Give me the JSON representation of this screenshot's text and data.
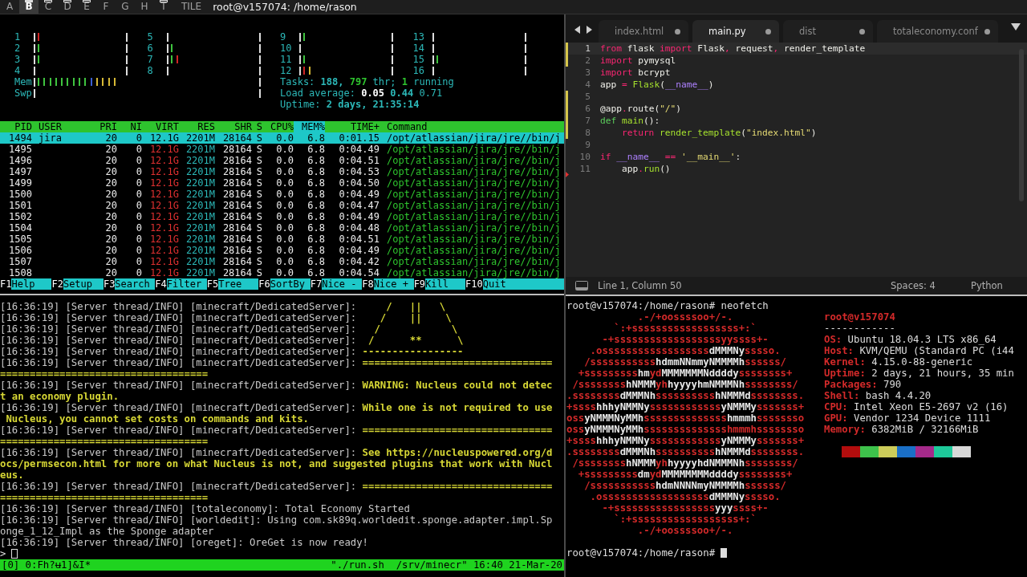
{
  "topbar": {
    "workspaces": [
      {
        "label": "A",
        "selected": false,
        "occupied": false
      },
      {
        "label": "B",
        "selected": true,
        "occupied": true
      },
      {
        "label": "C",
        "selected": false,
        "occupied": true
      },
      {
        "label": "D",
        "selected": false,
        "occupied": true
      },
      {
        "label": "E",
        "selected": false,
        "occupied": true
      },
      {
        "label": "F",
        "selected": false,
        "occupied": false
      },
      {
        "label": "G",
        "selected": false,
        "occupied": false
      },
      {
        "label": "H",
        "selected": false,
        "occupied": false
      },
      {
        "label": "T",
        "selected": false,
        "occupied": true
      }
    ],
    "layout": "TILE",
    "window_title": "root@v157074: /home/rason"
  },
  "htop": {
    "cpus": [
      {
        "label": "1",
        "bars": [
          {
            "color": "#d02525"
          }
        ]
      },
      {
        "label": "2",
        "bars": [
          {
            "color": "#3fc43f"
          }
        ]
      },
      {
        "label": "3",
        "bars": [
          {
            "color": "#3fc43f"
          }
        ]
      },
      {
        "label": "4"
      },
      {
        "label": "5"
      },
      {
        "label": "6",
        "bars": [
          {
            "color": "#3fc43f"
          }
        ]
      },
      {
        "label": "7",
        "bars": [
          {
            "color": "#3fc43f"
          },
          {
            "color": "#d02525"
          }
        ]
      },
      {
        "label": "8"
      },
      {
        "label": "9",
        "bars": [
          {
            "color": "#3fc43f"
          }
        ]
      },
      {
        "label": "10"
      },
      {
        "label": "11",
        "bars": [
          {
            "color": "#3fc43f"
          }
        ]
      },
      {
        "label": "12",
        "bars": [
          {
            "color": "#d02525"
          },
          {
            "color": "#d7b935"
          }
        ]
      },
      {
        "label": "13"
      },
      {
        "label": "14"
      },
      {
        "label": "15",
        "bars": [
          {
            "color": "#3fc43f"
          }
        ]
      },
      {
        "label": "16"
      }
    ],
    "memory": [
      {
        "label": "Mem",
        "bars": [
          {
            "color": "#3fc43f"
          },
          {
            "color": "#3fc43f"
          },
          {
            "color": "#3fc43f"
          },
          {
            "color": "#3fc43f"
          },
          {
            "color": "#3fc43f"
          },
          {
            "color": "#3fc43f"
          },
          {
            "color": "#3fc43f"
          },
          {
            "color": "#3fc43f"
          },
          {
            "color": "#3fc43f"
          },
          {
            "color": "#3b5fd0"
          },
          {
            "color": "#d7b935"
          },
          {
            "color": "#d7b935"
          },
          {
            "color": "#d7b935"
          },
          {
            "color": "#d7b935"
          }
        ]
      },
      {
        "label": "Swp"
      }
    ],
    "summary": [
      [
        {
          "text": "Tasks: ",
          "kind": "label"
        },
        {
          "text": "188, ",
          "kind": "value"
        },
        {
          "text": "797",
          "kind": "highlight"
        },
        {
          "text": " thr; ",
          "kind": "label"
        },
        {
          "text": "1",
          "kind": "highlight"
        },
        {
          "text": " running",
          "kind": "label"
        }
      ],
      [
        {
          "text": "Load average: ",
          "kind": "label"
        },
        {
          "text": "0.05 ",
          "kind": "bright"
        },
        {
          "text": "0.44 ",
          "kind": "value"
        },
        {
          "text": "0.71",
          "kind": "label"
        }
      ],
      [
        {
          "text": "Uptime: ",
          "kind": "label"
        },
        {
          "text": "2 days, 21:35:14",
          "kind": "value"
        }
      ]
    ],
    "columns": [
      {
        "label": "PID",
        "selected": false
      },
      {
        "label": "USER",
        "selected": false
      },
      {
        "label": "PRI",
        "selected": false
      },
      {
        "label": "NI",
        "selected": false
      },
      {
        "label": "VIRT",
        "selected": false
      },
      {
        "label": "RES",
        "selected": false
      },
      {
        "label": "SHR",
        "selected": false
      },
      {
        "label": "S",
        "selected": false
      },
      {
        "label": "CPU%",
        "selected": false
      },
      {
        "label": "MEM%",
        "selected": true
      },
      {
        "label": "TIME+",
        "selected": false
      },
      {
        "label": "Command",
        "selected": false
      }
    ],
    "rows": [
      {
        "selected": true,
        "pid": "1494",
        "user": "jira",
        "pri": "20",
        "ni": "0",
        "virt": "12.1G",
        "res": "2201M",
        "shr": "28164",
        "state": "S",
        "cpu": "0.0",
        "mem": "6.8",
        "time": "0:01.15",
        "command": "/opt/atlassian/jira/jre//bin/j"
      },
      {
        "selected": false,
        "pid": "1495",
        "pri": "20",
        "ni": "0",
        "virt": "12.1G",
        "res": "2201M",
        "shr": "28164",
        "state": "S",
        "cpu": "0.0",
        "mem": "6.8",
        "time": "0:04.49",
        "command": "/opt/atlassian/jira/jre//bin/j"
      },
      {
        "selected": false,
        "pid": "1496",
        "pri": "20",
        "ni": "0",
        "virt": "12.1G",
        "res": "2201M",
        "shr": "28164",
        "state": "S",
        "cpu": "0.0",
        "mem": "6.8",
        "time": "0:04.51",
        "command": "/opt/atlassian/jira/jre//bin/j"
      },
      {
        "selected": false,
        "pid": "1497",
        "pri": "20",
        "ni": "0",
        "virt": "12.1G",
        "res": "2201M",
        "shr": "28164",
        "state": "S",
        "cpu": "0.0",
        "mem": "6.8",
        "time": "0:04.53",
        "command": "/opt/atlassian/jira/jre//bin/j"
      },
      {
        "selected": false,
        "pid": "1499",
        "pri": "20",
        "ni": "0",
        "virt": "12.1G",
        "res": "2201M",
        "shr": "28164",
        "state": "S",
        "cpu": "0.0",
        "mem": "6.8",
        "time": "0:04.50",
        "command": "/opt/atlassian/jira/jre//bin/j"
      },
      {
        "selected": false,
        "pid": "1500",
        "pri": "20",
        "ni": "0",
        "virt": "12.1G",
        "res": "2201M",
        "shr": "28164",
        "state": "S",
        "cpu": "0.0",
        "mem": "6.8",
        "time": "0:04.49",
        "command": "/opt/atlassian/jira/jre//bin/j"
      },
      {
        "selected": false,
        "pid": "1501",
        "pri": "20",
        "ni": "0",
        "virt": "12.1G",
        "res": "2201M",
        "shr": "28164",
        "state": "S",
        "cpu": "0.0",
        "mem": "6.8",
        "time": "0:04.47",
        "command": "/opt/atlassian/jira/jre//bin/j"
      },
      {
        "selected": false,
        "pid": "1502",
        "pri": "20",
        "ni": "0",
        "virt": "12.1G",
        "res": "2201M",
        "shr": "28164",
        "state": "S",
        "cpu": "0.0",
        "mem": "6.8",
        "time": "0:04.49",
        "command": "/opt/atlassian/jira/jre//bin/j"
      },
      {
        "selected": false,
        "pid": "1504",
        "pri": "20",
        "ni": "0",
        "virt": "12.1G",
        "res": "2201M",
        "shr": "28164",
        "state": "S",
        "cpu": "0.0",
        "mem": "6.8",
        "time": "0:04.48",
        "command": "/opt/atlassian/jira/jre//bin/j"
      },
      {
        "selected": false,
        "pid": "1505",
        "pri": "20",
        "ni": "0",
        "virt": "12.1G",
        "res": "2201M",
        "shr": "28164",
        "state": "S",
        "cpu": "0.0",
        "mem": "6.8",
        "time": "0:04.51",
        "command": "/opt/atlassian/jira/jre//bin/j"
      },
      {
        "selected": false,
        "pid": "1506",
        "pri": "20",
        "ni": "0",
        "virt": "12.1G",
        "res": "2201M",
        "shr": "28164",
        "state": "S",
        "cpu": "0.0",
        "mem": "6.8",
        "time": "0:04.49",
        "command": "/opt/atlassian/jira/jre//bin/j"
      },
      {
        "selected": false,
        "pid": "1507",
        "pri": "20",
        "ni": "0",
        "virt": "12.1G",
        "res": "2201M",
        "shr": "28164",
        "state": "S",
        "cpu": "0.0",
        "mem": "6.8",
        "time": "0:04.42",
        "command": "/opt/atlassian/jira/jre//bin/j"
      },
      {
        "selected": false,
        "pid": "1508",
        "pri": "20",
        "ni": "0",
        "virt": "12.1G",
        "res": "2201M",
        "shr": "28164",
        "state": "S",
        "cpu": "0.0",
        "mem": "6.8",
        "time": "0:04.54",
        "command": "/opt/atlassian/jira/jre//bin/j"
      }
    ],
    "function_keys": [
      {
        "key": "F1",
        "label": "Help"
      },
      {
        "key": "F2",
        "label": "Setup"
      },
      {
        "key": "F3",
        "label": "Search"
      },
      {
        "key": "F4",
        "label": "Filter"
      },
      {
        "key": "F5",
        "label": "Tree"
      },
      {
        "key": "F6",
        "label": "SortBy"
      },
      {
        "key": "F7",
        "label": "Nice -"
      },
      {
        "key": "F8",
        "label": "Nice +"
      },
      {
        "key": "F9",
        "label": "Kill"
      },
      {
        "key": "F10",
        "label": "Quit"
      }
    ]
  },
  "server_log": {
    "lines": [
      {
        "text": "[16:36:19] [Server thread/INFO] [minecraft/DedicatedServer]: ",
        "message": "    /   ||   \\"
      },
      {
        "text": "[16:36:19] [Server thread/INFO] [minecraft/DedicatedServer]: ",
        "message": "   /    ||    \\"
      },
      {
        "text": "[16:36:19] [Server thread/INFO] [minecraft/DedicatedServer]: ",
        "message": "  /            \\"
      },
      {
        "text": "[16:36:19] [Server thread/INFO] [minecraft/DedicatedServer]: ",
        "message": " /      **      \\"
      },
      {
        "text": "[16:36:19] [Server thread/INFO] [minecraft/DedicatedServer]: ",
        "message": "-----------------"
      },
      {
        "text": "[16:36:19] [Server thread/INFO] [minecraft/DedicatedServer]: ",
        "message": "================================"
      },
      {
        "message": "==================================="
      },
      {
        "text": "[16:36:19] [Server thread/INFO] [minecraft/DedicatedServer]: ",
        "message": "WARNING: Nucleus could not detec"
      },
      {
        "message": "t an economy plugin."
      },
      {
        "text": "[16:36:19] [Server thread/INFO] [minecraft/DedicatedServer]: ",
        "message": "While one is not required to use"
      },
      {
        "message": " Nucleus, you cannot set costs on commands and kits."
      },
      {
        "text": "[16:36:19] [Server thread/INFO] [minecraft/DedicatedServer]: ",
        "message": "================================"
      },
      {
        "message": "==================================="
      },
      {
        "text": "[16:36:19] [Server thread/INFO] [minecraft/DedicatedServer]: ",
        "message": "See https://nucleuspowered.org/d"
      },
      {
        "message": "ocs/permsecon.html for more on what Nucleus is not, and suggested plugins that work with Nucl"
      },
      {
        "message": "eus."
      },
      {
        "text": "[16:36:19] [Server thread/INFO] [minecraft/DedicatedServer]: ",
        "message": "================================"
      },
      {
        "message": "==================================="
      },
      {
        "text": "[16:36:19] [Server thread/INFO] [totaleconomy]: Total Economy Started"
      },
      {
        "text": "[16:36:19] [Server thread/INFO] [worldedit]: Using com.sk89q.worldedit.sponge.adapter.impl.Sp"
      },
      {
        "text": "onge_1_12_Impl as the Sponge adapter"
      },
      {
        "text": "[16:36:19] [Server thread/INFO] [oreget]: OreGet is now ready!"
      }
    ],
    "prompt": ">",
    "status_left": "[0] 0:Fh?ʉ1]&I*",
    "status_right": "\"./run.sh  /srv/minecr\" 16:40 21-Mar-20"
  },
  "editor": {
    "tabs": [
      {
        "label": "index.html",
        "selected": false,
        "modified": true
      },
      {
        "label": "main.py",
        "selected": true,
        "modified": true
      },
      {
        "label": "dist",
        "selected": false,
        "modified": true
      },
      {
        "label": "totaleconomy.conf",
        "selected": false,
        "modified": true
      }
    ],
    "lines": [
      {
        "number": "1",
        "current": true,
        "changed": true,
        "deletion": false,
        "tokens": [
          {
            "text": "from",
            "kind": "keyword"
          },
          {
            "text": " flask ",
            "kind": "plain"
          },
          {
            "text": "import",
            "kind": "keyword"
          },
          {
            "text": " Flask",
            "kind": "plain"
          },
          {
            "text": ",",
            "kind": "keyword"
          },
          {
            "text": " request",
            "kind": "plain"
          },
          {
            "text": ",",
            "kind": "keyword"
          },
          {
            "text": " render_template",
            "kind": "plain"
          }
        ]
      },
      {
        "number": "2",
        "current": false,
        "changed": true,
        "deletion": false,
        "tokens": [
          {
            "text": "import",
            "kind": "keyword"
          },
          {
            "text": " pymysql",
            "kind": "plain"
          }
        ]
      },
      {
        "number": "3",
        "current": false,
        "changed": false,
        "deletion": false,
        "tokens": [
          {
            "text": "import",
            "kind": "keyword"
          },
          {
            "text": " bcrypt",
            "kind": "plain"
          }
        ]
      },
      {
        "number": "4",
        "current": false,
        "changed": false,
        "deletion": false,
        "tokens": [
          {
            "text": "app ",
            "kind": "plain"
          },
          {
            "text": "= ",
            "kind": "keyword"
          },
          {
            "text": "Flask",
            "kind": "function"
          },
          {
            "text": "(",
            "kind": "plain"
          },
          {
            "text": "__name__",
            "kind": "constant"
          },
          {
            "text": ")",
            "kind": "plain"
          }
        ]
      },
      {
        "number": "5",
        "current": false,
        "changed": true,
        "deletion": false
      },
      {
        "number": "6",
        "current": false,
        "changed": true,
        "deletion": false,
        "tokens": [
          {
            "text": "@app",
            "kind": "plain"
          },
          {
            "text": ".",
            "kind": "keyword"
          },
          {
            "text": "route(",
            "kind": "plain"
          },
          {
            "text": "\"/\"",
            "kind": "string"
          },
          {
            "text": ")",
            "kind": "plain"
          }
        ]
      },
      {
        "number": "7",
        "current": false,
        "changed": true,
        "deletion": false,
        "tokens": [
          {
            "text": "def ",
            "kind": "storage"
          },
          {
            "text": "main",
            "kind": "function"
          },
          {
            "text": "():",
            "kind": "plain"
          }
        ]
      },
      {
        "number": "8",
        "current": false,
        "changed": true,
        "deletion": false,
        "tokens": [
          {
            "text": "    return ",
            "kind": "keyword"
          },
          {
            "text": "render_template",
            "kind": "function"
          },
          {
            "text": "(",
            "kind": "plain"
          },
          {
            "text": "\"index.html\"",
            "kind": "string"
          },
          {
            "text": ")",
            "kind": "plain"
          }
        ]
      },
      {
        "number": "9",
        "current": false,
        "changed": false,
        "deletion": false
      },
      {
        "number": "10",
        "current": false,
        "changed": false,
        "deletion": false,
        "tokens": [
          {
            "text": "if ",
            "kind": "keyword"
          },
          {
            "text": "__name__ ",
            "kind": "constant"
          },
          {
            "text": "== ",
            "kind": "keyword"
          },
          {
            "text": "'__main__'",
            "kind": "string"
          },
          {
            "text": ":",
            "kind": "plain"
          }
        ]
      },
      {
        "number": "11",
        "current": false,
        "changed": false,
        "deletion": true,
        "tokens": [
          {
            "text": "    app",
            "kind": "plain"
          },
          {
            "text": ".",
            "kind": "keyword"
          },
          {
            "text": "run",
            "kind": "function"
          },
          {
            "text": "()",
            "kind": "plain"
          }
        ]
      }
    ],
    "status": {
      "position": "Line 1, Column 50",
      "indentation": "Spaces: 4",
      "syntax": "Python"
    }
  },
  "terminal": {
    "command_line": "root@v157074:/home/rason# neofetch",
    "logo": [
      [
        {
          "text": "            .-/+oossssoo+/-.",
          "kind": "red"
        }
      ],
      [
        {
          "text": "        `:+ssssssssssssssssss+:`",
          "kind": "red"
        }
      ],
      [
        {
          "text": "      -+ssssssssssssssssssyyssss+-",
          "kind": "red"
        }
      ],
      [
        {
          "text": "    .ossssssssssssssssss",
          "kind": "red"
        },
        {
          "text": "dMMMNy",
          "kind": "white"
        },
        {
          "text": "sssso.",
          "kind": "red"
        }
      ],
      [
        {
          "text": "   /sssssssssss",
          "kind": "red"
        },
        {
          "text": "hdmmNNmmyNMMMMh",
          "kind": "white"
        },
        {
          "text": "ssssss/",
          "kind": "red"
        }
      ],
      [
        {
          "text": "  +sssssssss",
          "kind": "red"
        },
        {
          "text": "hm",
          "kind": "white"
        },
        {
          "text": "yd",
          "kind": "red"
        },
        {
          "text": "MMMMMMMNddddy",
          "kind": "white"
        },
        {
          "text": "ssssssss+",
          "kind": "red"
        }
      ],
      [
        {
          "text": " /ssssssss",
          "kind": "red"
        },
        {
          "text": "hNMMM",
          "kind": "white"
        },
        {
          "text": "yh",
          "kind": "red"
        },
        {
          "text": "hyyyyhmNMMMNh",
          "kind": "white"
        },
        {
          "text": "ssssssss/",
          "kind": "red"
        }
      ],
      [
        {
          "text": ".ssssssss",
          "kind": "red"
        },
        {
          "text": "dMMMNh",
          "kind": "white"
        },
        {
          "text": "ssssssssss",
          "kind": "red"
        },
        {
          "text": "hNMMMd",
          "kind": "white"
        },
        {
          "text": "ssssssss.",
          "kind": "red"
        }
      ],
      [
        {
          "text": "+ssss",
          "kind": "red"
        },
        {
          "text": "hhhyNMMNy",
          "kind": "white"
        },
        {
          "text": "ssssssssssss",
          "kind": "red"
        },
        {
          "text": "yNMMMy",
          "kind": "white"
        },
        {
          "text": "sssssss+",
          "kind": "red"
        }
      ],
      [
        {
          "text": "oss",
          "kind": "red"
        },
        {
          "text": "yNMMMNyMMh",
          "kind": "white"
        },
        {
          "text": "ssssssssssssss",
          "kind": "red"
        },
        {
          "text": "hmmmh",
          "kind": "white"
        },
        {
          "text": "ssssssso",
          "kind": "red"
        }
      ],
      [
        {
          "text": "oss",
          "kind": "red"
        },
        {
          "text": "yNMMMNyMMh",
          "kind": "white"
        },
        {
          "text": "sssssssssssssshmmmhssssssso",
          "kind": "red"
        }
      ],
      [
        {
          "text": "+ssss",
          "kind": "red"
        },
        {
          "text": "hhhyNMMNy",
          "kind": "white"
        },
        {
          "text": "ssssssssssss",
          "kind": "red"
        },
        {
          "text": "yNMMMy",
          "kind": "white"
        },
        {
          "text": "sssssss+",
          "kind": "red"
        }
      ],
      [
        {
          "text": ".ssssssss",
          "kind": "red"
        },
        {
          "text": "dMMMNh",
          "kind": "white"
        },
        {
          "text": "ssssssssss",
          "kind": "red"
        },
        {
          "text": "hNMMMd",
          "kind": "white"
        },
        {
          "text": "ssssssss.",
          "kind": "red"
        }
      ],
      [
        {
          "text": " /ssssssss",
          "kind": "red"
        },
        {
          "text": "hNMMM",
          "kind": "white"
        },
        {
          "text": "yh",
          "kind": "red"
        },
        {
          "text": "hyyyyhdNMMMNh",
          "kind": "white"
        },
        {
          "text": "ssssssss/",
          "kind": "red"
        }
      ],
      [
        {
          "text": "  +sssssssss",
          "kind": "red"
        },
        {
          "text": "dm",
          "kind": "white"
        },
        {
          "text": "yd",
          "kind": "red"
        },
        {
          "text": "MMMMMMMMddddy",
          "kind": "white"
        },
        {
          "text": "ssssssss+",
          "kind": "red"
        }
      ],
      [
        {
          "text": "   /sssssssssss",
          "kind": "red"
        },
        {
          "text": "hdmNNNNmyNMMMMh",
          "kind": "white"
        },
        {
          "text": "ssssss/",
          "kind": "red"
        }
      ],
      [
        {
          "text": "    .ossssssssssssssssss",
          "kind": "red"
        },
        {
          "text": "dMMMNy",
          "kind": "white"
        },
        {
          "text": "sssso.",
          "kind": "red"
        }
      ],
      [
        {
          "text": "      -+sssssssssssssssss",
          "kind": "red"
        },
        {
          "text": "yyy",
          "kind": "white"
        },
        {
          "text": "ssss+-",
          "kind": "red"
        }
      ],
      [
        {
          "text": "        `:+ssssssssssssssssss+:`",
          "kind": "red"
        }
      ],
      [
        {
          "text": "            .-/+oossssoo+/-.",
          "kind": "red"
        }
      ]
    ],
    "info_title": "root@v157074",
    "info_separator": "------------",
    "info": [
      {
        "key": "OS:",
        "value": " Ubuntu 18.04.3 LTS x86_64"
      },
      {
        "key": "Host:",
        "value": " KVM/QEMU (Standard PC (i44"
      },
      {
        "key": "Kernel:",
        "value": " 4.15.0-88-generic"
      },
      {
        "key": "Uptime:",
        "value": " 2 days, 21 hours, 35 min"
      },
      {
        "key": "Packages:",
        "value": " 790"
      },
      {
        "key": "Shell:",
        "value": " bash 4.4.20"
      },
      {
        "key": "CPU:",
        "value": " Intel Xeon E5-2697 v2 (16)"
      },
      {
        "key": "GPU:",
        "value": " Vendor 1234 Device 1111"
      },
      {
        "key": "Memory:",
        "value": " 6382MiB / 32166MiB"
      }
    ],
    "palette": [
      {
        "color": "#b30d0d"
      },
      {
        "color": "#3ec24b"
      },
      {
        "color": "#cccc5a"
      },
      {
        "color": "#1a6fc7"
      },
      {
        "color": "#a52a8a"
      },
      {
        "color": "#1ec99a"
      },
      {
        "color": "#d8d8d8"
      }
    ],
    "prompt": "root@v157074:/home/rason#"
  }
}
